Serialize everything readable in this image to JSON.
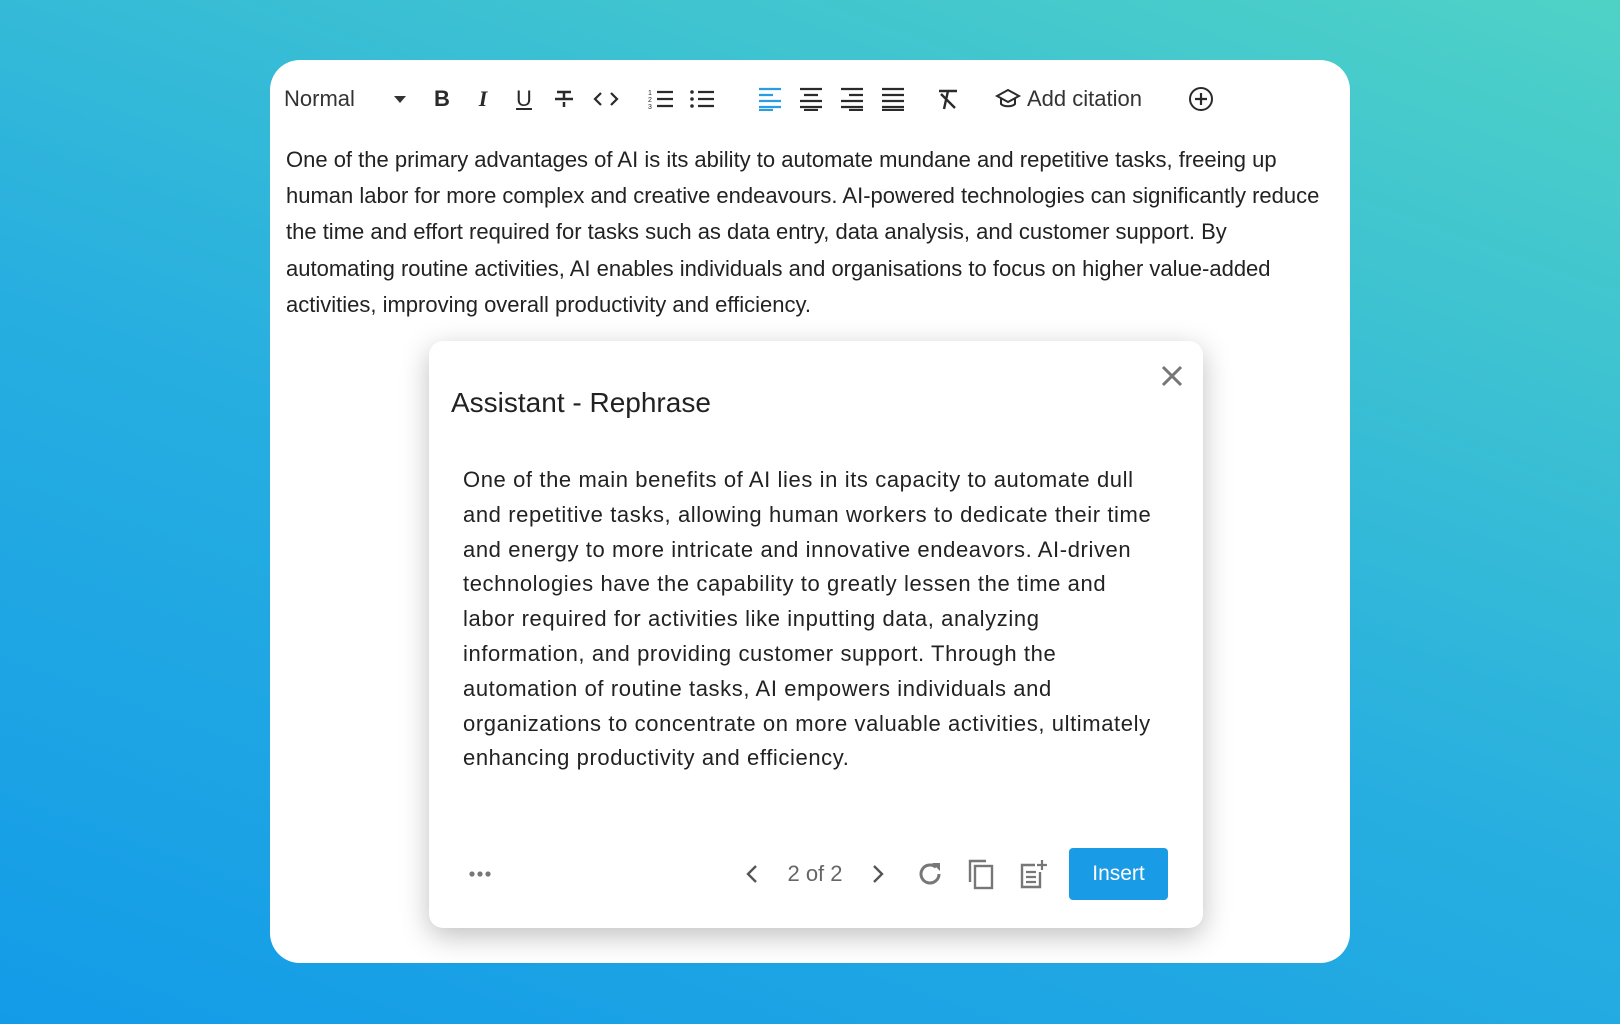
{
  "toolbar": {
    "format": "Normal",
    "icons": [
      "chevron-down-icon",
      "bold-icon",
      "italic-icon",
      "underline-icon",
      "strikethrough-icon",
      "code-icon",
      "ordered-list-icon",
      "bullet-list-icon",
      "align-left-icon",
      "align-center-icon",
      "align-right-icon",
      "align-justify-icon",
      "clear-format-icon",
      "graduation-cap-icon",
      "add-circle-icon"
    ],
    "add_citation": "Add citation",
    "active_color": "#2a9de0"
  },
  "editor": {
    "text": "One of the primary advantages of AI is its ability to automate mundane and repetitive tasks, freeing up human labor for more complex and creative endeavours. AI-powered technologies can significantly reduce the time and effort required for tasks such as data entry, data analysis, and customer support. By automating routine activities, AI enables individuals and organisations to focus on higher value-added activities, improving overall productivity and efficiency."
  },
  "dialog": {
    "title": "Assistant - Rephrase",
    "body": "One of the main benefits of AI lies in its capacity to automate dull and repetitive tasks, allowing human workers to dedicate their time and energy to more intricate and innovative endeavors. AI-driven technologies have the capability to greatly lessen the time and labor required for activities like inputting data, analyzing information, and providing customer support. Through the automation of routine tasks, AI empowers individuals and organizations to concentrate on more valuable activities, ultimately enhancing productivity and efficiency.",
    "pager": "2 of 2",
    "insert_label": "Insert",
    "accent": "#1a9be6"
  }
}
